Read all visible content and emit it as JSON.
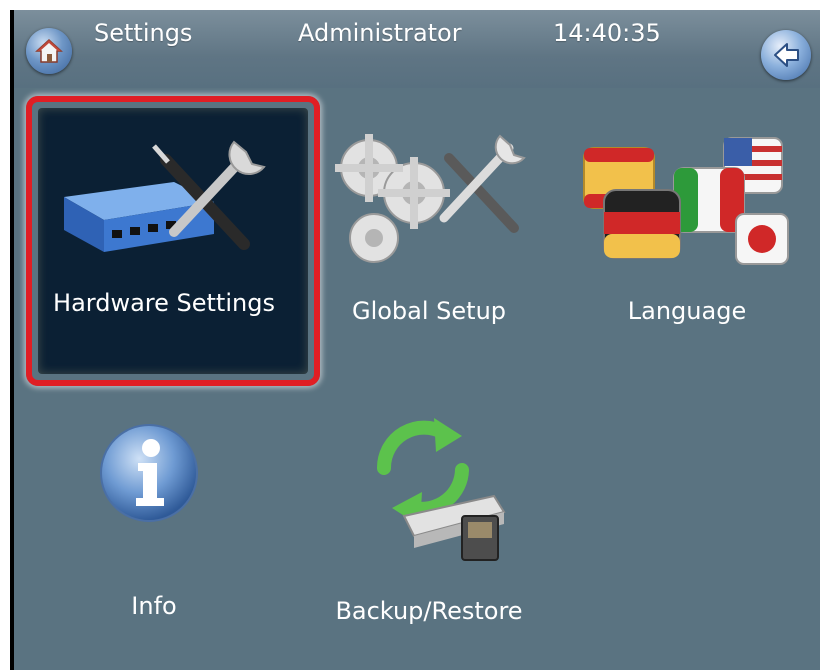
{
  "topbar": {
    "title": "Settings",
    "user": "Administrator",
    "time": "14:40:35"
  },
  "tiles": [
    {
      "label": "Hardware Settings",
      "icon": "network-switch-tools-icon",
      "selected": true
    },
    {
      "label": "Global Setup",
      "icon": "gears-tools-icon",
      "selected": false
    },
    {
      "label": "Language",
      "icon": "flags-icon",
      "selected": false
    },
    {
      "label": "Info",
      "icon": "info-icon",
      "selected": false
    },
    {
      "label": "Backup/Restore",
      "icon": "backup-restore-icon",
      "selected": false
    }
  ],
  "colors": {
    "background": "#5a7381",
    "selection_border": "#e01e24",
    "selected_tile": "#0b2034"
  }
}
